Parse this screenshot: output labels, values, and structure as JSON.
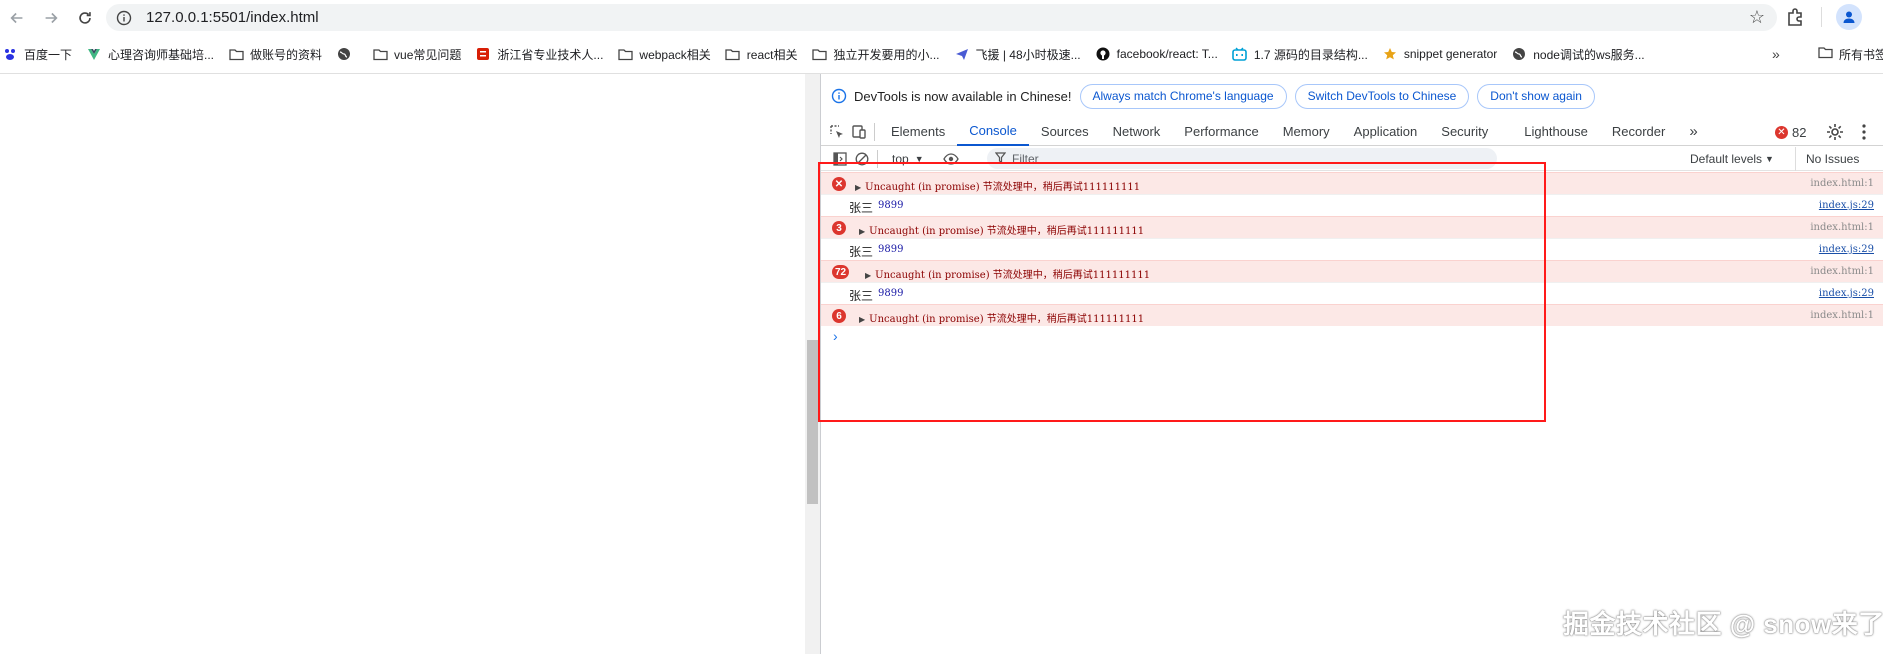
{
  "browser": {
    "url": "127.0.0.1:5501/index.html"
  },
  "bookmarks": [
    {
      "label": "百度一下",
      "icon": "paw-icon"
    },
    {
      "label": "心理咨询师基础培...",
      "icon": "vue-icon"
    },
    {
      "label": "做账号的资料",
      "icon": "folder-icon"
    },
    {
      "label": "",
      "icon": "globe-icon"
    },
    {
      "label": "vue常见问题",
      "icon": "folder-icon"
    },
    {
      "label": "浙江省专业技术人...",
      "icon": "site-icon"
    },
    {
      "label": "webpack相关",
      "icon": "folder-icon"
    },
    {
      "label": "react相关",
      "icon": "folder-icon"
    },
    {
      "label": "独立开发要用的小...",
      "icon": "folder-icon"
    },
    {
      "label": "飞援 | 48小时极速...",
      "icon": "plane-icon"
    },
    {
      "label": "facebook/react: T...",
      "icon": "github-icon"
    },
    {
      "label": "1.7 源码的目录结构...",
      "icon": "bilibili-icon"
    },
    {
      "label": "snippet generator",
      "icon": "star-icon"
    },
    {
      "label": "node调试的ws服务...",
      "icon": "globe-icon"
    }
  ],
  "bookmarks_more": "»",
  "bookmarks_all": "所有书签",
  "devtools": {
    "info_message": "DevTools is now available in Chinese!",
    "btn_match": "Always match Chrome's language",
    "btn_switch": "Switch DevTools to Chinese",
    "btn_dont_show": "Don't show again",
    "tabs": [
      "Elements",
      "Console",
      "Sources",
      "Network",
      "Performance",
      "Memory",
      "Application",
      "Security",
      "Lighthouse",
      "Recorder"
    ],
    "tabs_more": "»",
    "error_count": "82",
    "context": "top",
    "filter_placeholder": "Filter",
    "levels": "Default levels",
    "issues": "No Issues"
  },
  "console": {
    "messages": [
      {
        "type": "error",
        "badge": "",
        "text": "Uncaught (in promise) 节流处理中，稍后再试111111111",
        "source": "index.html:1"
      },
      {
        "type": "log",
        "name": "张三",
        "value": "9899",
        "source": "index.js:29"
      },
      {
        "type": "error",
        "badge": "3",
        "text": "Uncaught (in promise) 节流处理中，稍后再试111111111",
        "source": "index.html:1"
      },
      {
        "type": "log",
        "name": "张三",
        "value": "9899",
        "source": "index.js:29"
      },
      {
        "type": "error",
        "badge": "72",
        "text": "Uncaught (in promise) 节流处理中，稍后再试111111111",
        "source": "index.html:1"
      },
      {
        "type": "log",
        "name": "张三",
        "value": "9899",
        "source": "index.js:29"
      },
      {
        "type": "error",
        "badge": "6",
        "text": "Uncaught (in promise) 节流处理中，稍后再试111111111",
        "source": "index.html:1"
      }
    ],
    "prompt": "›"
  },
  "watermark": "掘金技术社区 @ snow来了"
}
